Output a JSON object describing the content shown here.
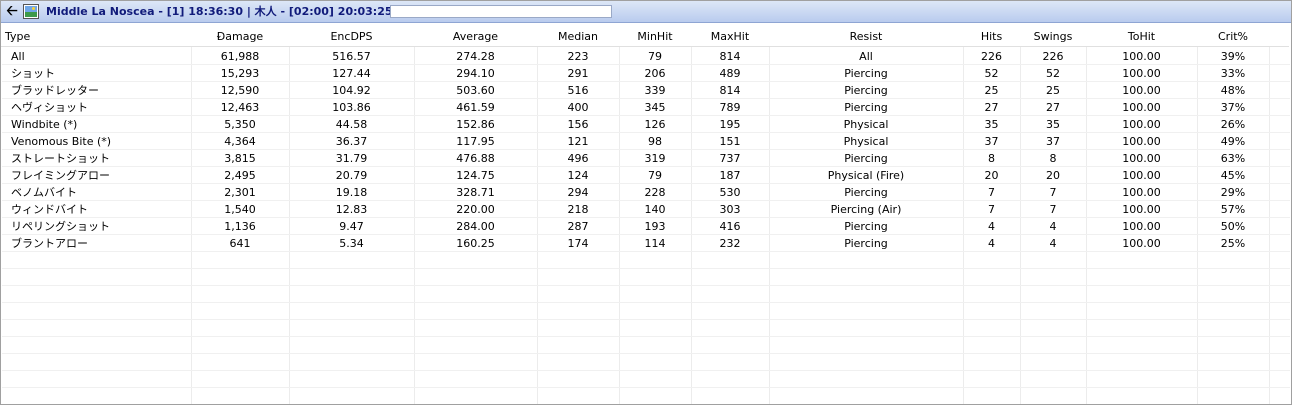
{
  "window": {
    "title": "Middle La Noscea - [1] 18:36:30 | 木人 - [02:00] 20:03:25 |"
  },
  "table": {
    "sort_indicator": "⌄",
    "columns": [
      {
        "key": "type",
        "label": "Type"
      },
      {
        "key": "damage",
        "label": "Damage"
      },
      {
        "key": "encdps",
        "label": "EncDPS"
      },
      {
        "key": "average",
        "label": "Average"
      },
      {
        "key": "median",
        "label": "Median"
      },
      {
        "key": "minhit",
        "label": "MinHit"
      },
      {
        "key": "maxhit",
        "label": "MaxHit"
      },
      {
        "key": "resist",
        "label": "Resist"
      },
      {
        "key": "hits",
        "label": "Hits"
      },
      {
        "key": "swings",
        "label": "Swings"
      },
      {
        "key": "tohit",
        "label": "ToHit"
      },
      {
        "key": "crit",
        "label": "Crit%"
      }
    ],
    "rows": [
      [
        "All",
        "61,988",
        "516.57",
        "274.28",
        "223",
        "79",
        "814",
        "All",
        "226",
        "226",
        "100.00",
        "39%"
      ],
      [
        "ショット",
        "15,293",
        "127.44",
        "294.10",
        "291",
        "206",
        "489",
        "Piercing",
        "52",
        "52",
        "100.00",
        "33%"
      ],
      [
        "ブラッドレッター",
        "12,590",
        "104.92",
        "503.60",
        "516",
        "339",
        "814",
        "Piercing",
        "25",
        "25",
        "100.00",
        "48%"
      ],
      [
        "ヘヴィショット",
        "12,463",
        "103.86",
        "461.59",
        "400",
        "345",
        "789",
        "Piercing",
        "27",
        "27",
        "100.00",
        "37%"
      ],
      [
        "Windbite (*)",
        "5,350",
        "44.58",
        "152.86",
        "156",
        "126",
        "195",
        "Physical",
        "35",
        "35",
        "100.00",
        "26%"
      ],
      [
        "Venomous Bite (*)",
        "4,364",
        "36.37",
        "117.95",
        "121",
        "98",
        "151",
        "Physical",
        "37",
        "37",
        "100.00",
        "49%"
      ],
      [
        "ストレートショット",
        "3,815",
        "31.79",
        "476.88",
        "496",
        "319",
        "737",
        "Piercing",
        "8",
        "8",
        "100.00",
        "63%"
      ],
      [
        "フレイミングアロー",
        "2,495",
        "20.79",
        "124.75",
        "124",
        "79",
        "187",
        "Physical (Fire)",
        "20",
        "20",
        "100.00",
        "45%"
      ],
      [
        "ベノムバイト",
        "2,301",
        "19.18",
        "328.71",
        "294",
        "228",
        "530",
        "Piercing",
        "7",
        "7",
        "100.00",
        "29%"
      ],
      [
        "ウィンドバイト",
        "1,540",
        "12.83",
        "220.00",
        "218",
        "140",
        "303",
        "Piercing (Air)",
        "7",
        "7",
        "100.00",
        "57%"
      ],
      [
        "リペリングショット",
        "1,136",
        "9.47",
        "284.00",
        "287",
        "193",
        "416",
        "Piercing",
        "4",
        "4",
        "100.00",
        "50%"
      ],
      [
        "ブラントアロー",
        "641",
        "5.34",
        "160.25",
        "174",
        "114",
        "232",
        "Piercing",
        "4",
        "4",
        "100.00",
        "25%"
      ]
    ]
  }
}
